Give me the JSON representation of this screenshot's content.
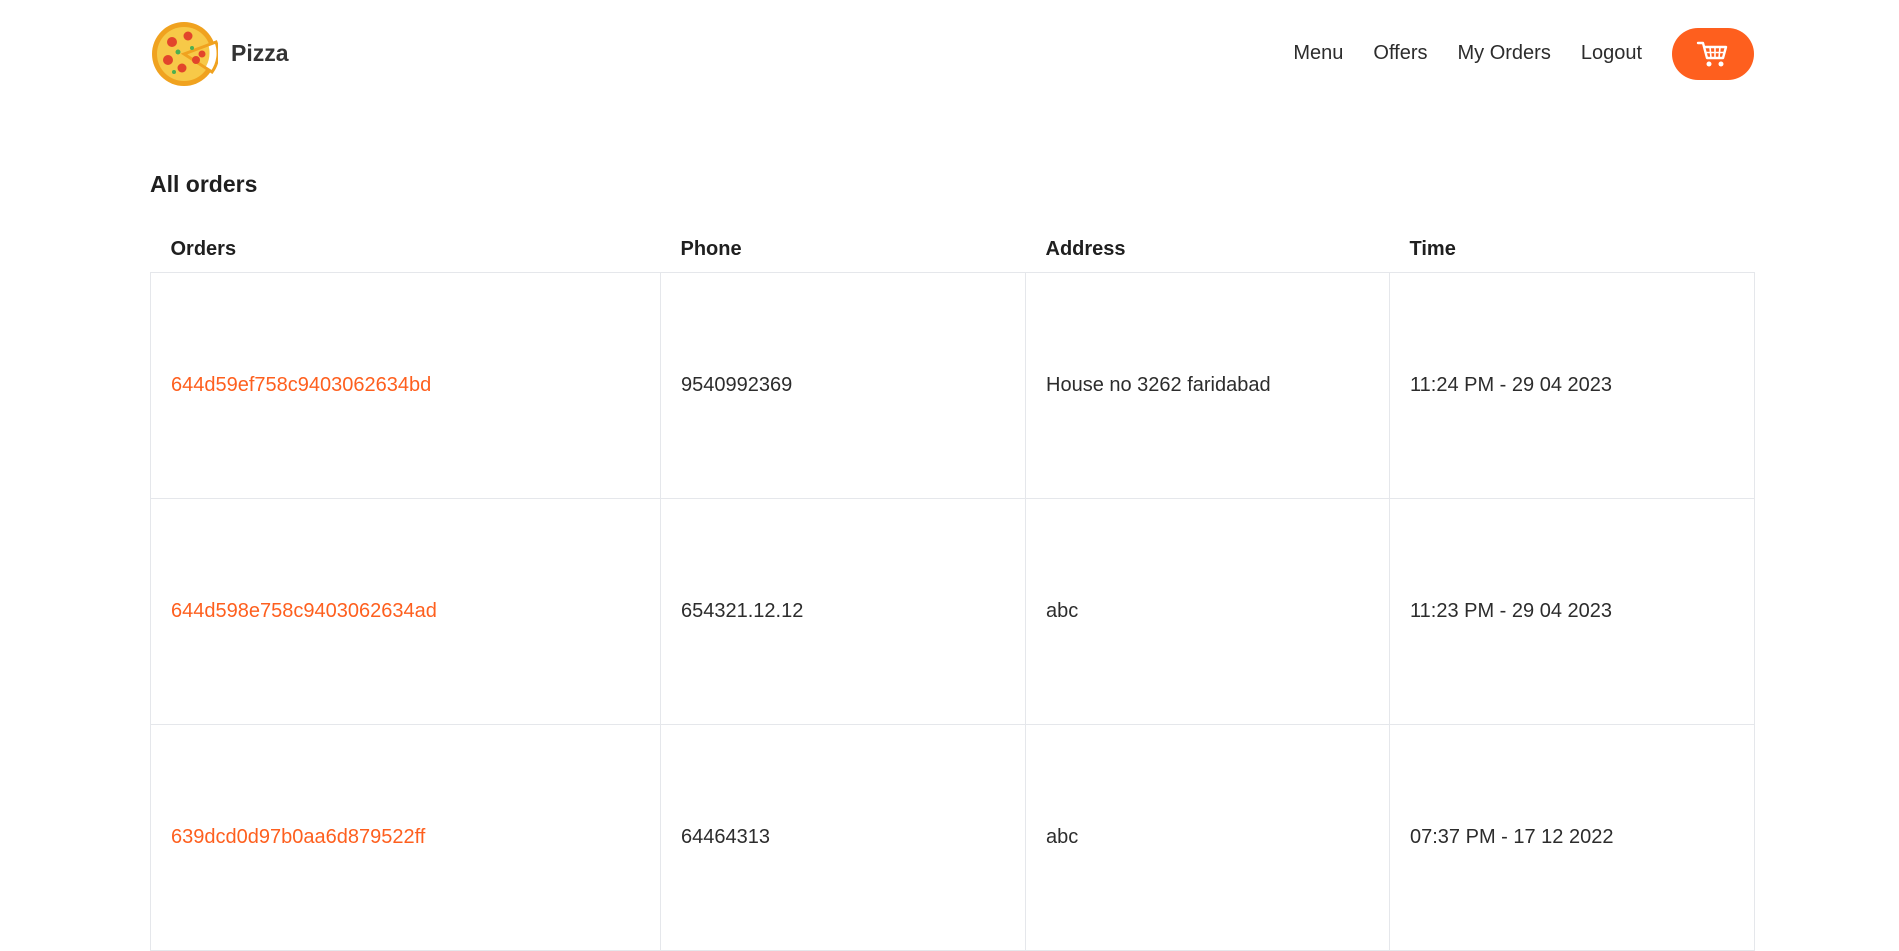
{
  "header": {
    "brand_name": "Pizza",
    "nav": {
      "menu": "Menu",
      "offers": "Offers",
      "my_orders": "My Orders",
      "logout": "Logout"
    },
    "cart_icon": "cart-icon",
    "accent_color": "#fe5f1e"
  },
  "main": {
    "title": "All orders",
    "columns": [
      "Orders",
      "Phone",
      "Address",
      "Time"
    ],
    "rows": [
      {
        "order_id": "644d59ef758c9403062634bd",
        "phone": "9540992369",
        "address": "House no 3262 faridabad",
        "time": "11:24 PM - 29 04 2023"
      },
      {
        "order_id": "644d598e758c9403062634ad",
        "phone": "654321.12.12",
        "address": "abc",
        "time": "11:23 PM - 29 04 2023"
      },
      {
        "order_id": "639dcd0d97b0aa6d879522ff",
        "phone": "64464313",
        "address": "abc",
        "time": "07:37 PM - 17 12 2022"
      }
    ]
  }
}
